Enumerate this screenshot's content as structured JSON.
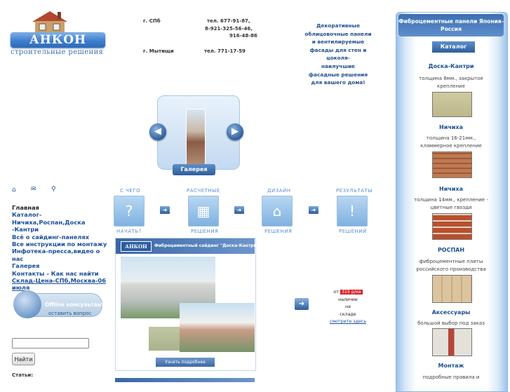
{
  "logo": {
    "name": "АНКОН",
    "tagline": "строительные решения"
  },
  "contacts": {
    "city1": "г. СПб",
    "phone1_line1": "тел. 677-91-87,",
    "phone1_line2": "8-921-325-56-46,",
    "phone1_line3": "916-48-86",
    "city2": "г. Мытищи",
    "phone2": "тел. 771-17-59"
  },
  "promo": {
    "line1": "Декоративные",
    "line2": "облицовочные панели",
    "line3": "и вентилируемые",
    "line4": "фасады  для стен и",
    "line5": "цоколя-",
    "line6": "наилучшие",
    "line7": "фасадные решения",
    "line8": "для вашего дома!"
  },
  "gallery": {
    "label": "Галерея",
    "prev": "◀",
    "next": "▶"
  },
  "top_icons": {
    "home": "home-icon",
    "mail": "mail-icon",
    "search": "search-icon"
  },
  "nav": {
    "items": [
      "Главная",
      "Каталог-Ничиха,Роспан,Доска",
      "-Кантри",
      "Всё о сайдинг-панелях",
      "Все инструкции по монтажу",
      "Инфотека-пресса,видео о нас",
      "Галерея",
      "Контакты - Как нас найти",
      "Склад-Цена-СПб,Москва-06",
      "июля"
    ]
  },
  "consultant": {
    "status": "Offline консультант",
    "action": "оставить вопрос"
  },
  "search": {
    "value": "",
    "button": "Найти"
  },
  "stats": {
    "label": "Статьи:"
  },
  "steps": [
    {
      "top": "С ЧЕГО",
      "bottom": "НАЧАТЬ?",
      "glyph": "?"
    },
    {
      "top": "РАСЧЕТНЫЕ",
      "bottom": "РЕШЕНИЯ",
      "glyph": "▦"
    },
    {
      "top": "ДИЗАЙН",
      "bottom": "РЕШЕНИЯ",
      "glyph": "⌂"
    },
    {
      "top": "РЕЗУЛЬТАТЫ",
      "bottom": "РЕШЕНИЙ",
      "glyph": "!"
    }
  ],
  "banner": {
    "logo": "АНКОН",
    "title": "Фиброцементный сайдинг \"Доска-Кантри\"",
    "button": "Узнать подробнее"
  },
  "price": {
    "from": "от",
    "amount": "315 р/кв",
    "line2": "наличие",
    "line3": "на",
    "line4": "складе",
    "link": "смотрите здесь"
  },
  "sidebar": {
    "header": "Фиброцементные панели Япония-Россия",
    "catalog": "Каталог",
    "products": [
      {
        "title": "Доска-Кантри",
        "desc1": "толщина 8мм., закрытое",
        "desc2": "крепление",
        "swatch": "#c9c49a"
      },
      {
        "title": "Ничиха",
        "desc1": "толщина 16-21мм.,",
        "desc2": "кляммерное крепление",
        "swatch": "#b8714a"
      },
      {
        "title": "Ничиха",
        "desc1": "толщина 14мм., крепление -",
        "desc2": "цветные гвозди",
        "swatch": "#b34a2e"
      },
      {
        "title": "РОСПАН",
        "desc1": "фиброцементные плиты",
        "desc2": "российского производства",
        "swatch": "#d8c19a"
      },
      {
        "title": "Аксессуары",
        "desc1": "большой выбор под заказ",
        "desc2": "",
        "swatch": "#d7d2cc"
      },
      {
        "title": "Монтаж",
        "desc1": "подробные правила и",
        "desc2": "",
        "swatch": ""
      }
    ]
  }
}
